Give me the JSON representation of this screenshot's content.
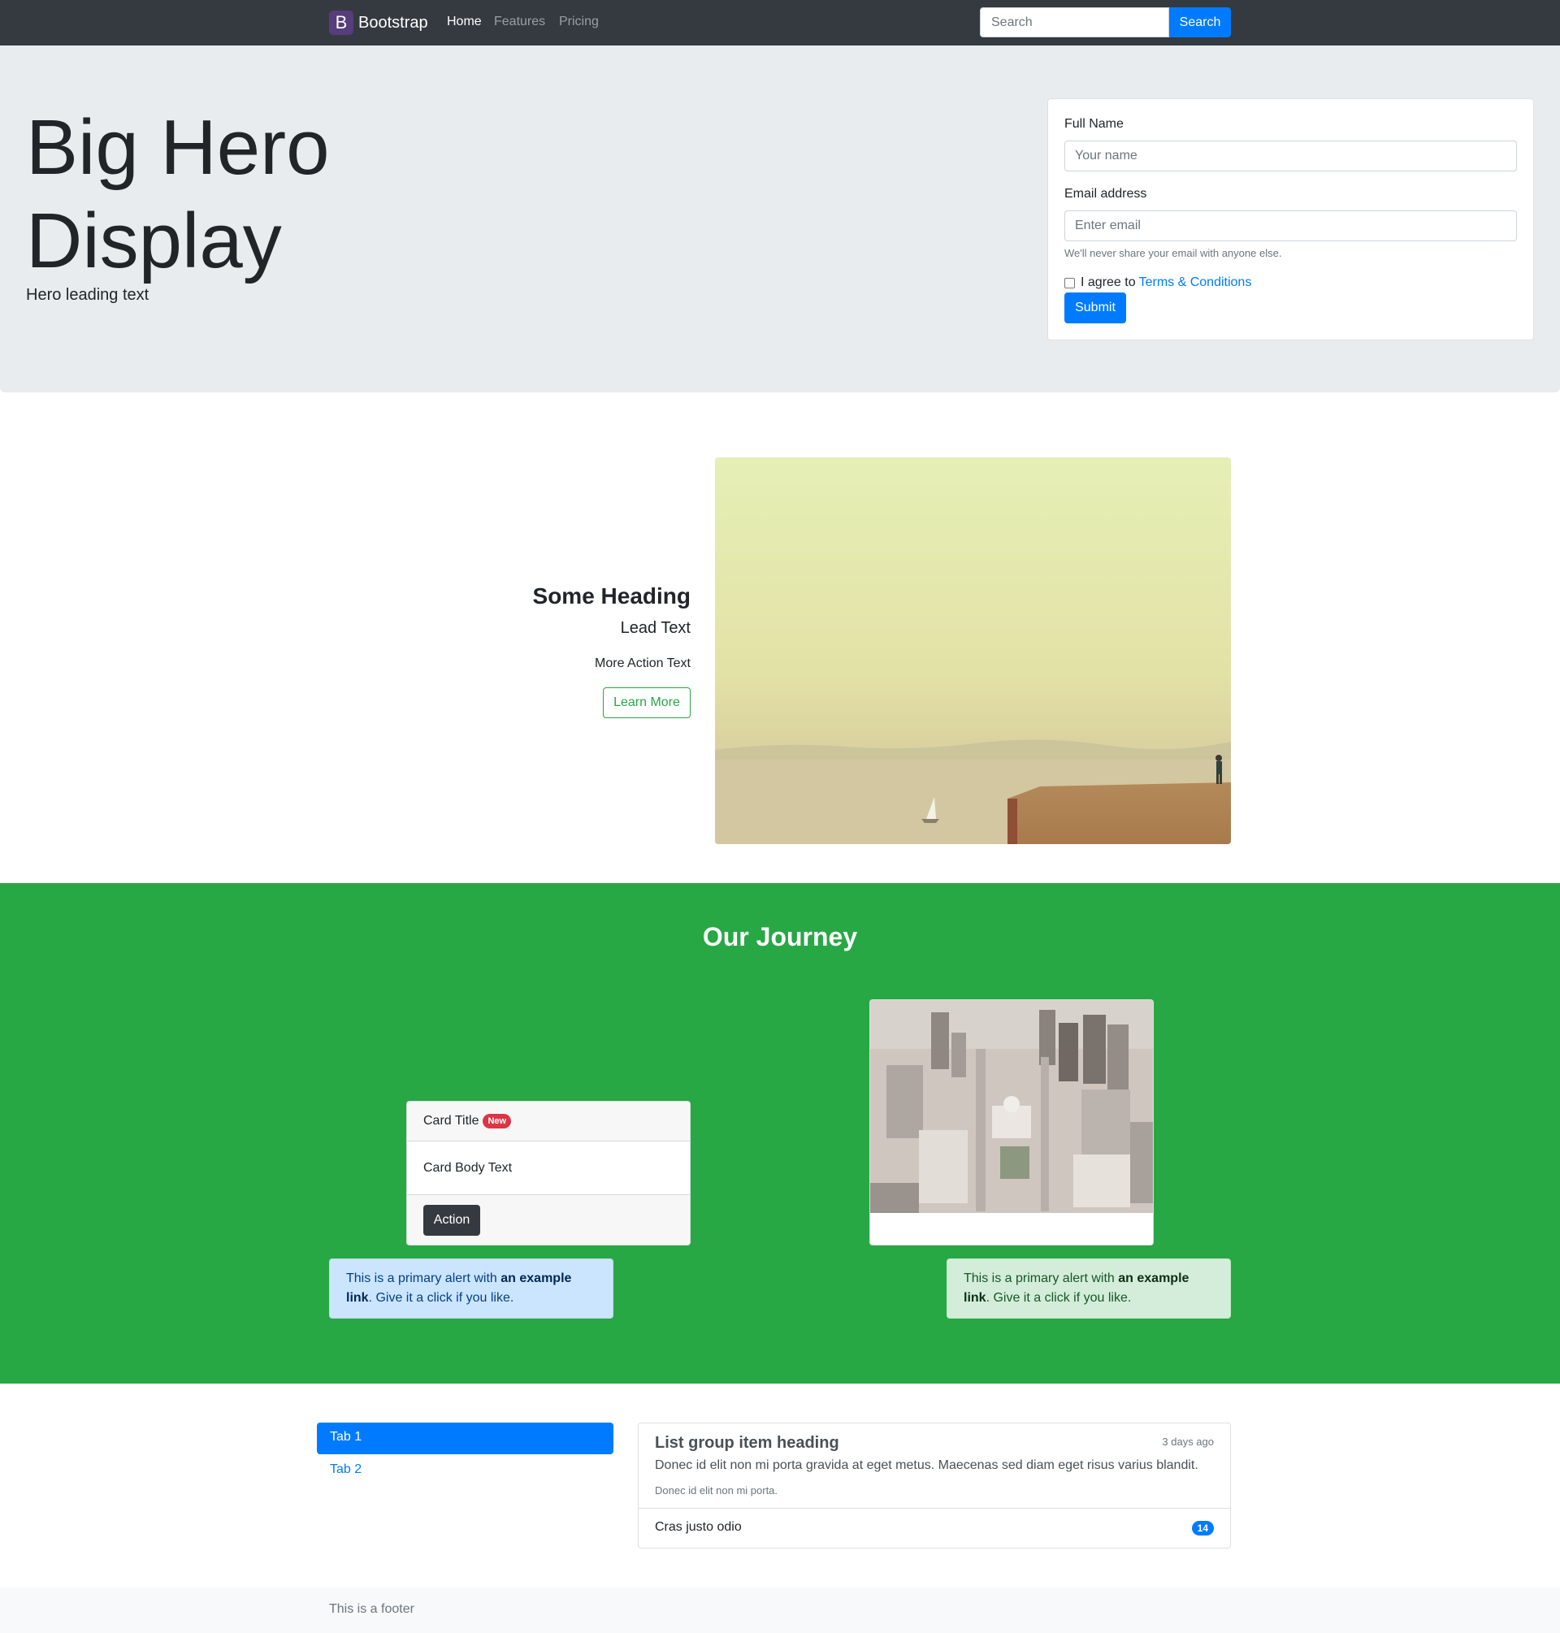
{
  "navbar": {
    "brand_letter": "B",
    "brand_name": "Bootstrap",
    "links": [
      "Home",
      "Features",
      "Pricing"
    ],
    "active_link": "Home",
    "search_placeholder": "Search",
    "search_button": "Search"
  },
  "hero": {
    "title": "Big Hero Display",
    "lead": "Hero leading text",
    "form": {
      "name_label": "Full Name",
      "name_placeholder": "Your name",
      "email_label": "Email address",
      "email_placeholder": "Enter email",
      "email_help": "We'll never share your email with anyone else.",
      "agree_text": "I agree to",
      "terms_link": "Terms & Conditions",
      "submit_label": "Submit",
      "agree_checked": false
    }
  },
  "feature": {
    "heading": "Some Heading",
    "lead": "Lead Text",
    "more": "More Action Text",
    "button": "Learn More"
  },
  "journey": {
    "title": "Our Journey",
    "card": {
      "title": "Card Title",
      "badge": "New",
      "body": "Card Body Text",
      "action": "Action"
    },
    "alerts": [
      {
        "pre": "This is a primary alert with ",
        "link": "an example link",
        "post": ". Give it a click if you like."
      },
      {
        "pre": "This is a primary alert with ",
        "link": "an example link",
        "post": ". Give it a click if you like."
      }
    ]
  },
  "tabs": [
    {
      "label": "Tab 1",
      "active": true
    },
    {
      "label": "Tab 2",
      "active": false
    }
  ],
  "list_group": {
    "heading": "List group item heading",
    "time": "3 days ago",
    "text": "Donec id elit non mi porta gravida at eget metus. Maecenas sed diam eget risus varius blandit.",
    "small": "Donec id elit non mi porta.",
    "item2": "Cras justo odio",
    "item2_badge": "14"
  },
  "footer": {
    "text": "This is a footer"
  },
  "colors": {
    "primary": "#007bff",
    "success": "#28a745",
    "danger": "#dc3545",
    "dark": "#343a40",
    "brand": "#563d7c"
  }
}
